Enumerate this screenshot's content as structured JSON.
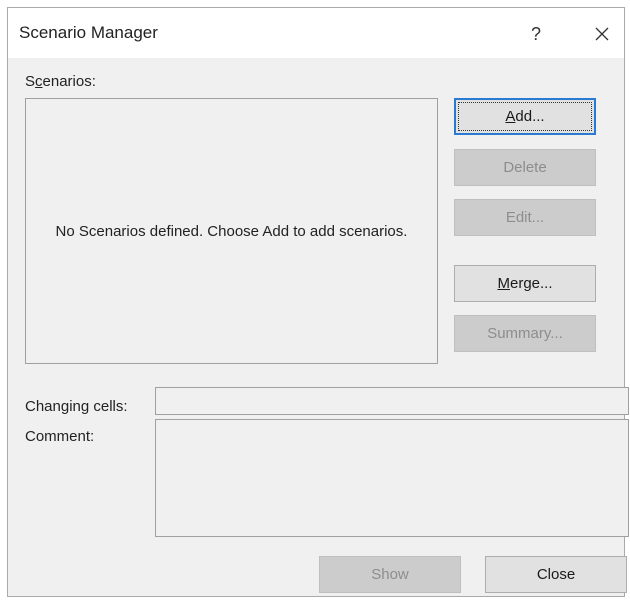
{
  "dialog": {
    "title": "Scenario Manager",
    "help_label": "?",
    "close_icon": "close-icon"
  },
  "scenarios": {
    "label_pre": "S",
    "label_hotkey": "c",
    "label_post": "enarios:",
    "empty_message": "No Scenarios defined. Choose Add to add scenarios."
  },
  "buttons": {
    "add": {
      "hotkey": "A",
      "rest": "dd...",
      "enabled": true,
      "default": true
    },
    "delete": {
      "label": "Delete",
      "enabled": false
    },
    "edit": {
      "label": "Edit...",
      "enabled": false
    },
    "merge": {
      "hotkey": "M",
      "rest": "erge...",
      "enabled": true
    },
    "summary": {
      "label": "Summary...",
      "enabled": false
    },
    "show": {
      "label": "Show",
      "enabled": false
    },
    "close": {
      "label": "Close",
      "enabled": true
    }
  },
  "fields": {
    "changing_cells_label": "Changing cells:",
    "changing_cells_value": "",
    "comment_label": "Comment:",
    "comment_value": ""
  },
  "colors": {
    "dialog_bg": "#f0f0f0",
    "titlebar_bg": "#ffffff",
    "default_button_border": "#2a7ad3",
    "disabled_text": "#8d8d8d"
  }
}
